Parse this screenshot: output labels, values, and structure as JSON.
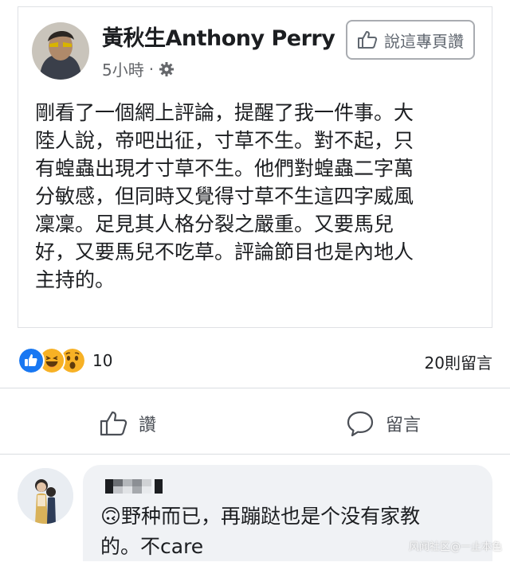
{
  "post": {
    "author": "黃秋生Anthony Perry",
    "time": "5小時",
    "privacy_separator": "·",
    "recommend_label": "說這專頁讚",
    "body_lines": [
      "剛看了一個網上評論，提醒了我一件事。大",
      "陸人說，帝吧出征，寸草不生。對不起，只",
      "有蝗蟲出現才寸草不生。他們對蝗蟲二字萬",
      "分敏感，但同時又覺得寸草不生這四字威風",
      "凜凜。足見其人格分裂之嚴重。又要馬兒",
      "好，又要馬兒不吃草。評論節目也是內地人",
      "主持的。"
    ],
    "reaction_count": "10",
    "comment_count": "20則留言"
  },
  "actions": {
    "like_label": "讚",
    "comment_label": "留言"
  },
  "comment": {
    "author_name_pixelated": true,
    "lines": [
      "🙃野种而已，再蹦跶也是个没有家教",
      "的。不care"
    ]
  },
  "watermark": "风闻社区@一止本色",
  "colors": {
    "like_blue": "#1877f2",
    "haha_yellow": "#f7b125",
    "secondary_text": "#65676b",
    "bubble_bg": "#f0f2f5"
  },
  "icons": {
    "recommend": "thumbs-up-outline-icon",
    "settings": "gear-icon",
    "like": "thumbs-up-outline-icon",
    "comment": "speech-bubble-icon",
    "reactions": [
      "like-reaction-icon",
      "haha-reaction-icon",
      "wow-reaction-icon"
    ]
  }
}
